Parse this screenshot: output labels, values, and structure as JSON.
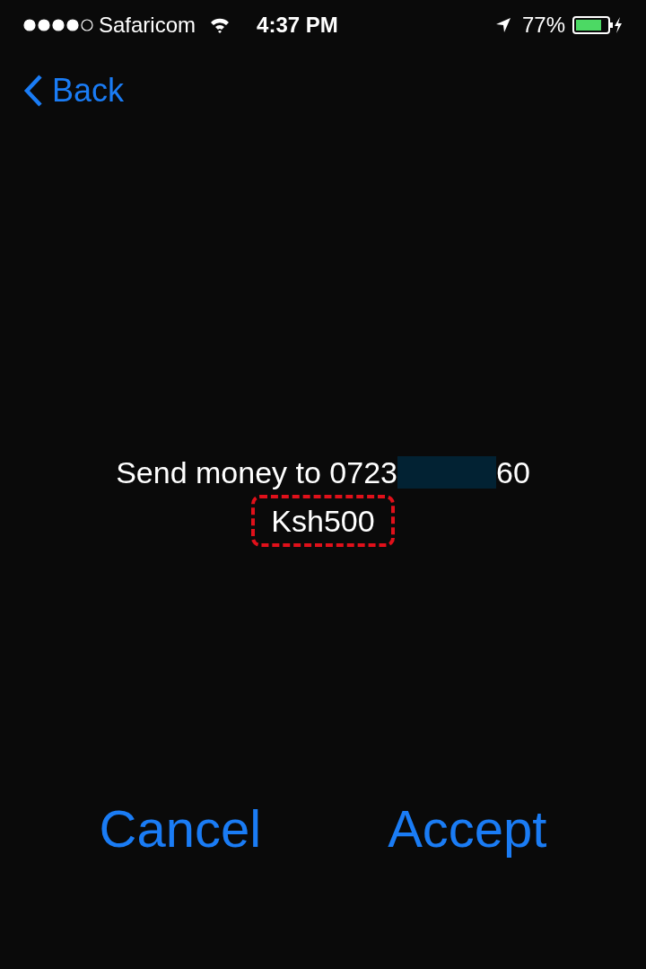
{
  "status_bar": {
    "carrier": "Safaricom",
    "time": "4:37 PM",
    "battery": "77%"
  },
  "nav": {
    "back": "Back"
  },
  "message": {
    "prefix": "Send money to 0723",
    "suffix": "60",
    "amount": "Ksh500",
    "redacted": true,
    "amount_highlighted": true
  },
  "buttons": [
    {
      "label": "Cancel"
    },
    {
      "label": "Accept"
    }
  ]
}
